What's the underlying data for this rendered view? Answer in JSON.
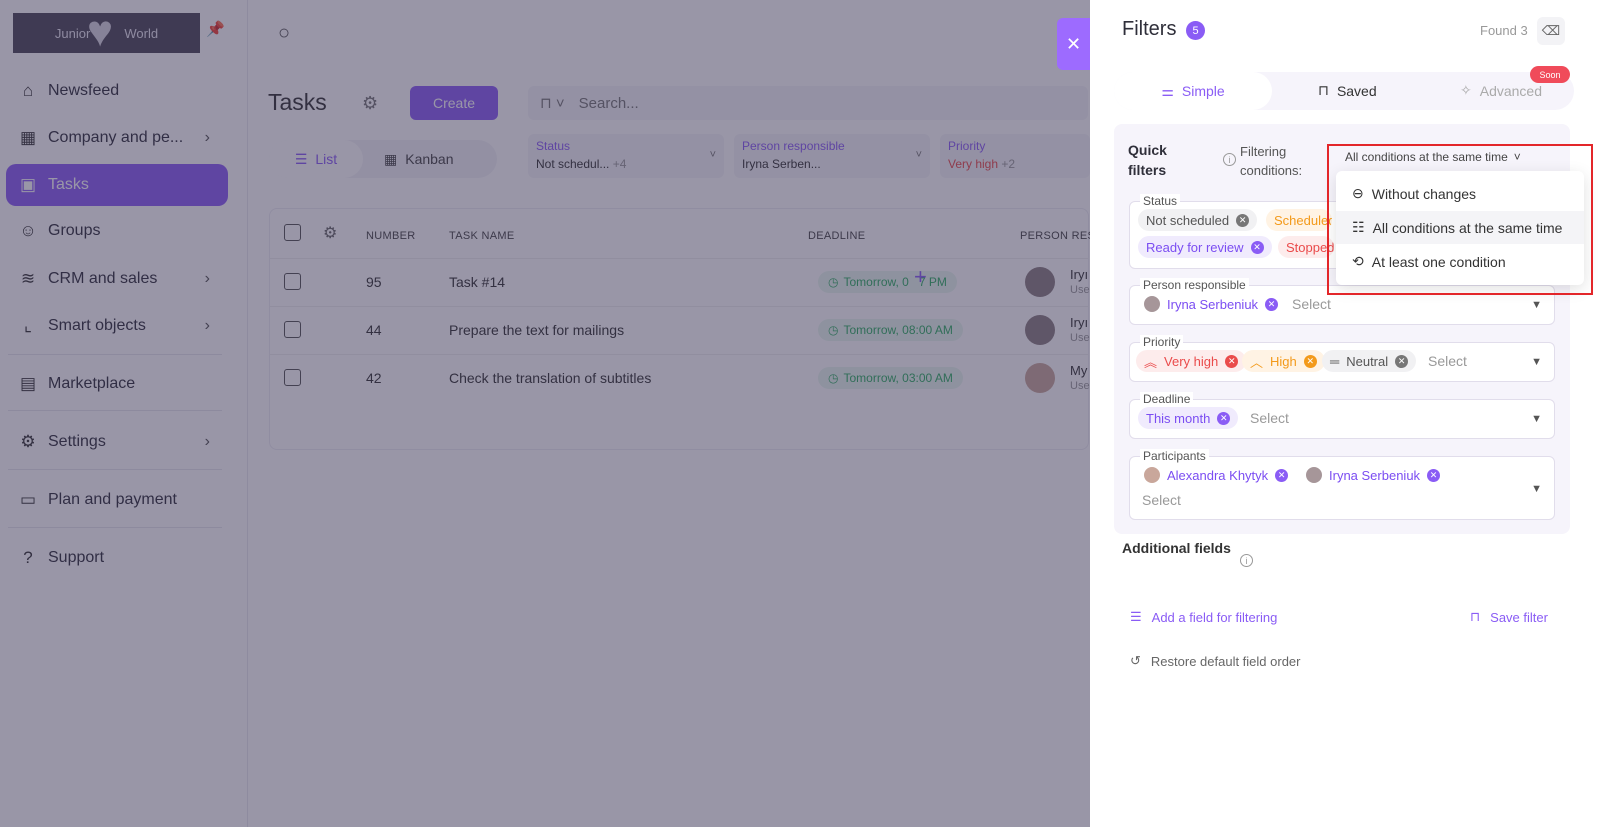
{
  "sidebar": {
    "logo_left": "Junior",
    "logo_right": "World",
    "items": [
      {
        "label": "Newsfeed",
        "icon": "home-icon"
      },
      {
        "label": "Company and pe...",
        "icon": "building-icon"
      },
      {
        "label": "Tasks",
        "icon": "calendar-icon"
      },
      {
        "label": "Groups",
        "icon": "users-icon"
      },
      {
        "label": "CRM and sales",
        "icon": "database-icon"
      },
      {
        "label": "Smart objects",
        "icon": "scan-icon"
      },
      {
        "label": "Marketplace",
        "icon": "store-icon"
      },
      {
        "label": "Settings",
        "icon": "gear-icon"
      },
      {
        "label": "Plan and payment",
        "icon": "wallet-icon"
      },
      {
        "label": "Support",
        "icon": "help-icon"
      }
    ]
  },
  "main": {
    "title": "Tasks",
    "create_label": "Create",
    "search_placeholder": "Search...",
    "views": {
      "list": "List",
      "kanban": "Kanban"
    },
    "filters": [
      {
        "label": "Status",
        "value": "Not schedul...",
        "extra": "+4"
      },
      {
        "label": "Person responsible",
        "value": "Iryna Serben..."
      },
      {
        "label": "Priority",
        "value": "Very high",
        "extra": "+2"
      }
    ],
    "columns": [
      "NUMBER",
      "TASK NAME",
      "DEADLINE",
      "PERSON RES"
    ],
    "rows": [
      {
        "number": "95",
        "name": "Task #14",
        "deadline": "Tomorrow, 0   7 PM",
        "user": "Iryı",
        "role": "Use"
      },
      {
        "number": "44",
        "name": "Prepare the text for mailings",
        "deadline": "Tomorrow, 08:00 AM",
        "user": "Iryı",
        "role": "Use"
      },
      {
        "number": "42",
        "name": "Check the translation of subtitles",
        "deadline": "Tomorrow, 03:00 AM",
        "user": "My",
        "role": "Use"
      }
    ]
  },
  "panel": {
    "title": "Filters",
    "count": "5",
    "found": "Found 3",
    "tabs": {
      "simple": "Simple",
      "saved": "Saved",
      "advanced": "Advanced",
      "soon": "Soon"
    },
    "quick_filters": "Quick filters",
    "filtering_conditions": "Filtering conditions:",
    "condition_selected": "All conditions at the same time",
    "dropdown": [
      "Without changes",
      "All conditions at the same time",
      "At least one condition"
    ],
    "select_placeholder": "Select",
    "fields": {
      "status": {
        "label": "Status",
        "tags": [
          "Not scheduled",
          "Scheduled",
          "Ready for review",
          "Stopped"
        ]
      },
      "person": {
        "label": "Person responsible",
        "tags": [
          "Iryna Serbeniuk"
        ]
      },
      "priority": {
        "label": "Priority",
        "tags": [
          "Very high",
          "High",
          "Neutral"
        ]
      },
      "deadline": {
        "label": "Deadline",
        "tags": [
          "This month"
        ]
      },
      "participants": {
        "label": "Participants",
        "tags": [
          "Alexandra Khytyk",
          "Iryna Serbeniuk"
        ]
      }
    },
    "additional_fields": "Additional fields",
    "add_field": "Add a field for filtering",
    "save_filter": "Save filter",
    "restore": "Restore default field order"
  },
  "colors": {
    "accent": "#8a5cf5",
    "highlight": "#e3262a"
  }
}
